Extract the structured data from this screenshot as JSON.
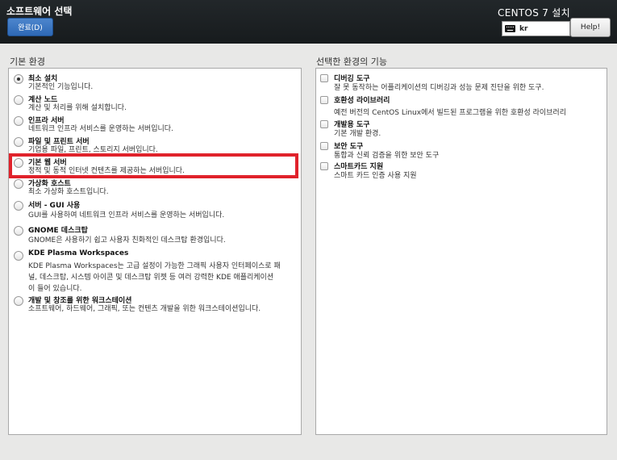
{
  "header": {
    "title": "소프트웨어 선택",
    "done_label": "완료(D)",
    "product": "CENTOS 7 설치",
    "keyboard_layout": "kr",
    "help_label": "Help!"
  },
  "left": {
    "heading": "기본 환경",
    "environments": [
      {
        "title": "최소 설치",
        "desc": [
          "기본적인 기능입니다."
        ],
        "selected": true
      },
      {
        "title": "계산 노드",
        "desc": [
          "계산 및 처리를 위해 설치합니다."
        ],
        "selected": false
      },
      {
        "title": "인프라 서버",
        "desc": [
          "네트워크 인프라 서비스를 운영하는 서버입니다."
        ],
        "selected": false
      },
      {
        "title": "파일 및 프린트 서버",
        "desc": [
          "기업용 파일, 프린트, 스토리지 서버입니다."
        ],
        "selected": false
      },
      {
        "title": "기본 웹 서버",
        "desc": [
          "정적 및 동적 인터넷 컨텐츠를 제공하는 서버입니다."
        ],
        "selected": false
      },
      {
        "title": "가상화 호스트",
        "desc": [
          "최소 가상화 호스트입니다."
        ],
        "selected": false
      },
      {
        "title": "서버 - GUI 사용",
        "desc": [
          "GUI를 사용하여 네트워크 인프라 서비스를 운영하는 서버입니다."
        ],
        "selected": false
      },
      {
        "title": "GNOME 데스크탑",
        "desc": [
          "GNOME은 사용하기 쉽고 사용자 친화적인 데스크탑 환경입니다."
        ],
        "selected": false
      },
      {
        "title": "KDE Plasma Workspaces",
        "desc": [
          "KDE Plasma Workspaces는 고급 설정이 가능한 그래픽 사용자 인터페이스로 패",
          "널, 데스크탑, 시스템 아이콘 및 데스크탑 위젯 등 여러 강력한 KDE 애플리케이션",
          "이 들어 있습니다."
        ],
        "selected": false
      },
      {
        "title": "개발 및 창조를 위한 워크스테이션",
        "desc": [
          "소프트웨어, 하드웨어, 그래픽, 또는 컨텐츠 개발을 위한 워크스테이션입니다."
        ],
        "selected": false
      }
    ]
  },
  "right": {
    "heading": "선택한 환경의 기능",
    "addons": [
      {
        "title": "디버깅 도구",
        "desc": "잘 못 동작하는 어플리케이션의 디버깅과 성능 문제 진단을 위한 도구."
      },
      {
        "title": "호환성 라이브러리",
        "desc": "예전 버전의 CentOS Linux에서 빌드된 프로그램을 위한 호환성 라이브러리"
      },
      {
        "title": "개발용 도구",
        "desc": "기본 개발 환경."
      },
      {
        "title": "보안 도구",
        "desc": "통합과 신뢰 검증을 위한 보안 도구"
      },
      {
        "title": "스마트카드 지원",
        "desc": "스마트 카드 인증 사용 지원"
      }
    ]
  },
  "colors": {
    "highlight": "#e0222b",
    "accent": "#2e69b6"
  }
}
